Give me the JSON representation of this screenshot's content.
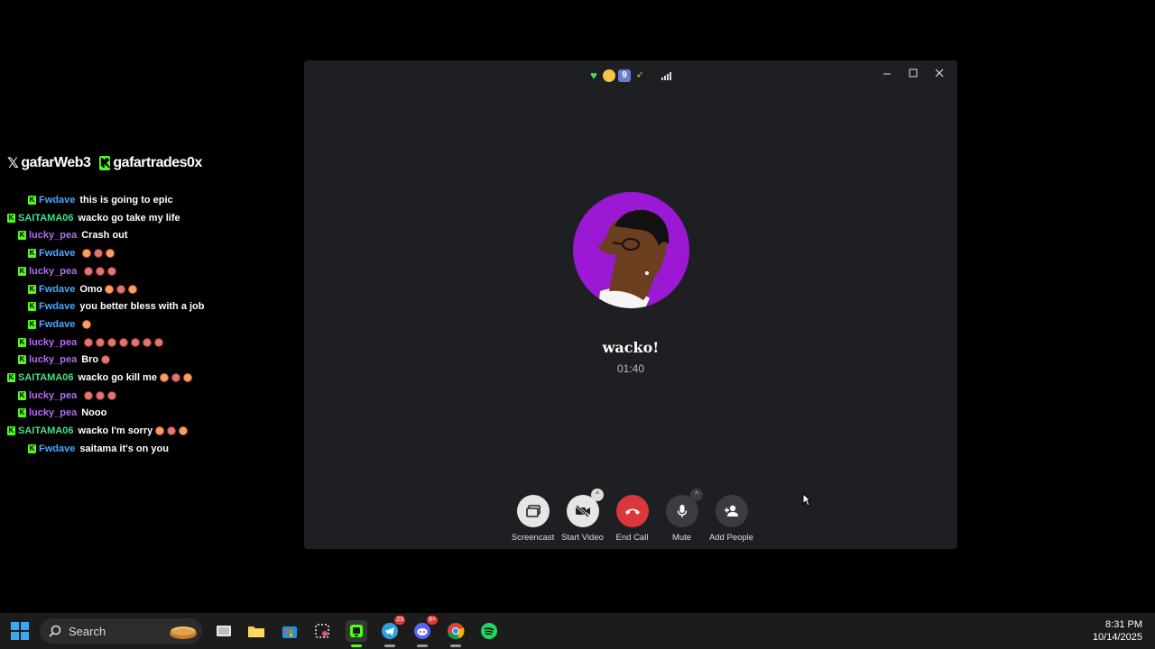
{
  "stream": {
    "handle_x": "gafarWeb3",
    "handle_kick": "gafartrades0x",
    "chat": [
      {
        "user": "Fwdave",
        "color": "blue",
        "text": "this is going to epic",
        "emotes": 0
      },
      {
        "user": "SAITAMA06",
        "color": "green",
        "text": "wacko go take my life",
        "emotes": 0
      },
      {
        "user": "lucky_pea",
        "color": "purple",
        "text": "Crash out",
        "emotes": 0
      },
      {
        "user": "Fwdave",
        "color": "blue",
        "text": "",
        "emotes": 3
      },
      {
        "user": "lucky_pea",
        "color": "purple",
        "text": "",
        "emotes": 3
      },
      {
        "user": "Fwdave",
        "color": "blue",
        "text": "Omo",
        "emotes": 3
      },
      {
        "user": "Fwdave",
        "color": "blue",
        "text": "you better bless with a job",
        "emotes": 0
      },
      {
        "user": "Fwdave",
        "color": "blue",
        "text": "",
        "emotes": 1
      },
      {
        "user": "lucky_pea",
        "color": "purple",
        "text": "",
        "emotes": 7
      },
      {
        "user": "lucky_pea",
        "color": "purple",
        "text": "Bro",
        "emotes": 1
      },
      {
        "user": "SAITAMA06",
        "color": "green",
        "text": "wacko go kill me",
        "emotes": 3
      },
      {
        "user": "lucky_pea",
        "color": "purple",
        "text": "",
        "emotes": 3
      },
      {
        "user": "lucky_pea",
        "color": "purple",
        "text": "Nooo",
        "emotes": 0
      },
      {
        "user": "SAITAMA06",
        "color": "green",
        "text": "wacko I'm sorry",
        "emotes": 3
      },
      {
        "user": "Fwdave",
        "color": "blue",
        "text": "saitama it's on you",
        "emotes": 0
      }
    ]
  },
  "call": {
    "caller_name": "wacko!",
    "timer": "01:40",
    "controls": {
      "screencast": "Screencast",
      "start_video": "Start Video",
      "end_call": "End Call",
      "mute": "Mute",
      "add_people": "Add People"
    }
  },
  "taskbar": {
    "search_label": "Search",
    "telegram_badge": "23",
    "discord_badge": "9+",
    "time": "8:31 PM",
    "date": "10/14/2025"
  },
  "colors": {
    "kick_green": "#53fc18",
    "end_call_red": "#da373c",
    "avatar_purple": "#9b19d4",
    "call_bg": "#1e1f22"
  }
}
